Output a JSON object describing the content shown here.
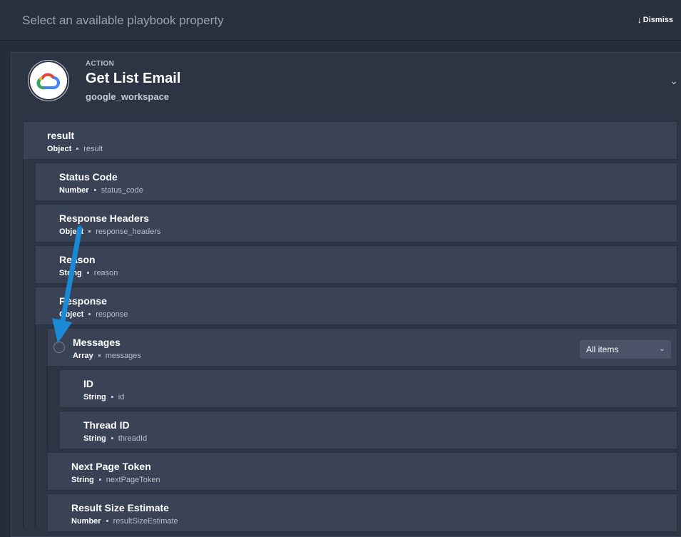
{
  "header": {
    "prompt": "Select an available playbook property",
    "dismiss_label": "Dismiss",
    "dismiss_icon": "arrow-down-icon"
  },
  "action": {
    "kicker": "ACTION",
    "title": "Get List Email",
    "integration": "google_workspace",
    "logo_icon": "google-cloud-icon",
    "collapse_icon": "chevron-down-icon"
  },
  "properties": {
    "result": {
      "label": "result",
      "type": "Object",
      "key": "result"
    },
    "status_code": {
      "label": "Status Code",
      "type": "Number",
      "key": "status_code"
    },
    "response_headers": {
      "label": "Response Headers",
      "type": "Object",
      "key": "response_headers"
    },
    "reason": {
      "label": "Reason",
      "type": "String",
      "key": "reason"
    },
    "response": {
      "label": "Response",
      "type": "Object",
      "key": "response"
    },
    "messages": {
      "label": "Messages",
      "type": "Array",
      "key": "messages",
      "selector_value": "All items"
    },
    "id": {
      "label": "ID",
      "type": "String",
      "key": "id"
    },
    "thread_id": {
      "label": "Thread ID",
      "type": "String",
      "key": "threadId"
    },
    "next_page_token": {
      "label": "Next Page Token",
      "type": "String",
      "key": "nextPageToken"
    },
    "result_size_estimate": {
      "label": "Result Size Estimate",
      "type": "Number",
      "key": "resultSizeEstimate"
    }
  },
  "colors": {
    "background": "#262d3a",
    "row": "#3a4255",
    "callout_arrow": "#1a8ad6"
  }
}
